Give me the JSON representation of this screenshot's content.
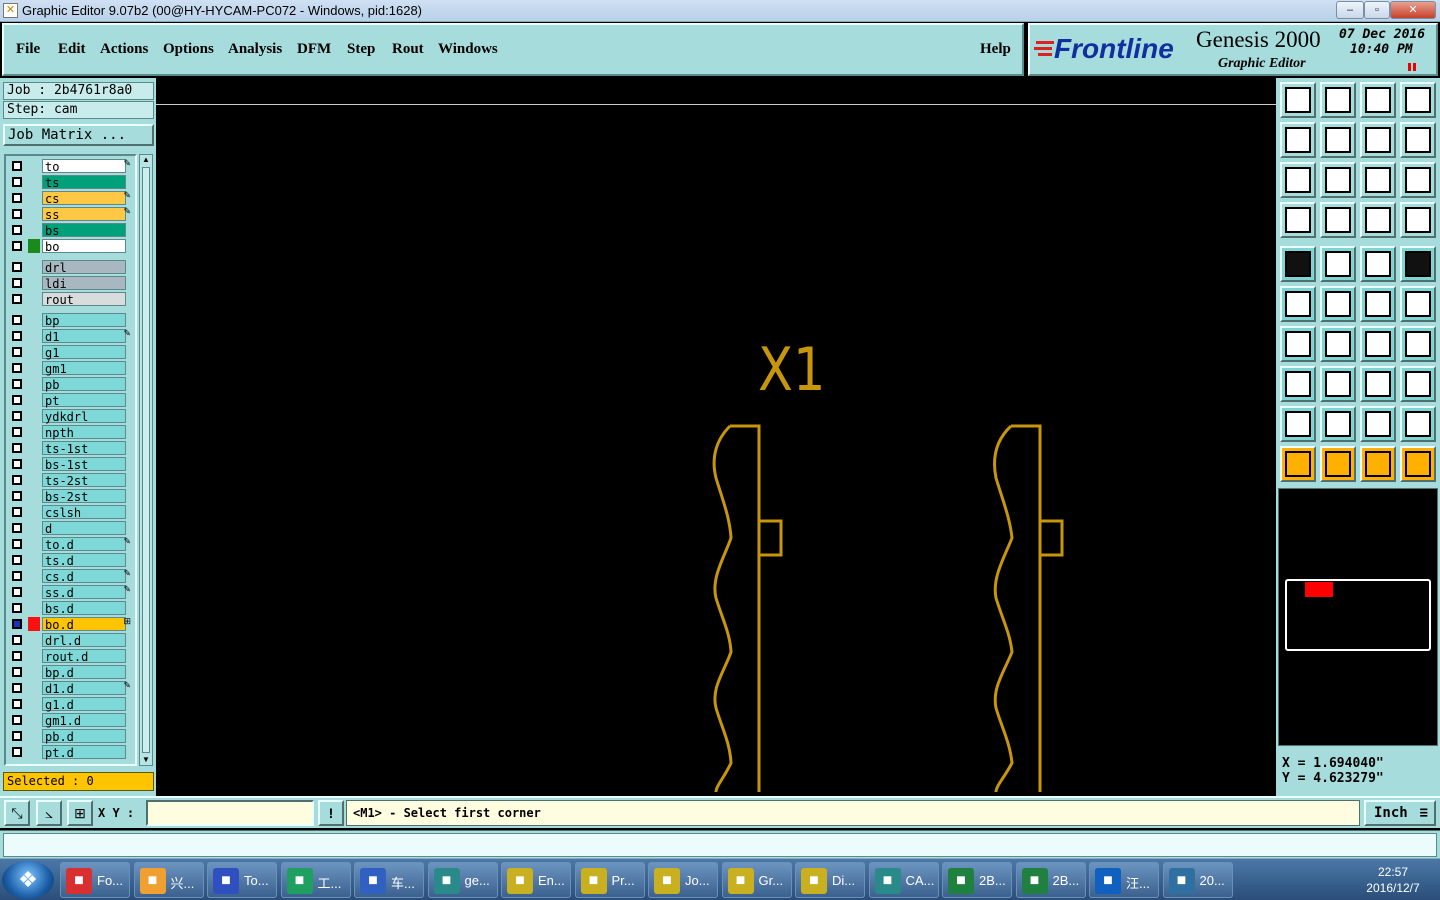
{
  "window": {
    "title": "Graphic Editor 9.07b2 (00@HY-HYCAM-PC072 - Windows, pid:1628)",
    "controls": [
      "–",
      "▫",
      "✕"
    ]
  },
  "menu": {
    "items": [
      "File",
      "Edit",
      "Actions",
      "Options",
      "Analysis",
      "DFM",
      "Step",
      "Rout",
      "Windows"
    ],
    "help": "Help"
  },
  "brand": {
    "logo": "Frontline",
    "product": "Genesis 2000",
    "subtitle": "Graphic Editor",
    "date": "07 Dec 2016",
    "time": "10:40 PM"
  },
  "job": {
    "job_label": "Job : 2b4761r8a0",
    "step_label": "Step: cam",
    "matrix_button": "Job Matrix ..."
  },
  "layers": [
    {
      "name": "to",
      "color": "#ffffff",
      "mark": "✎"
    },
    {
      "name": "ts",
      "color": "#00a07a",
      "mark": ""
    },
    {
      "name": "cs",
      "color": "#ffc844",
      "mark": "✎"
    },
    {
      "name": "ss",
      "color": "#ffc844",
      "mark": "✎"
    },
    {
      "name": "bs",
      "color": "#00a07a",
      "mark": ""
    },
    {
      "name": "bo",
      "color": "#ffffff",
      "mark": ""
    },
    {
      "name": "drl",
      "color": "#a9b8c0",
      "mark": ""
    },
    {
      "name": "ldi",
      "color": "#a9b8c0",
      "mark": ""
    },
    {
      "name": "rout",
      "color": "#d8dcdc",
      "mark": ""
    },
    {
      "name": "bp",
      "color": "#7fd8d8",
      "mark": ""
    },
    {
      "name": "d1",
      "color": "#7fd8d8",
      "mark": "✎"
    },
    {
      "name": "g1",
      "color": "#7fd8d8",
      "mark": ""
    },
    {
      "name": "gm1",
      "color": "#7fd8d8",
      "mark": ""
    },
    {
      "name": "pb",
      "color": "#7fd8d8",
      "mark": ""
    },
    {
      "name": "pt",
      "color": "#7fd8d8",
      "mark": ""
    },
    {
      "name": "ydkdrl",
      "color": "#7fd8d8",
      "mark": ""
    },
    {
      "name": "npth",
      "color": "#7fd8d8",
      "mark": ""
    },
    {
      "name": "ts-1st",
      "color": "#7fd8d8",
      "mark": ""
    },
    {
      "name": "bs-1st",
      "color": "#7fd8d8",
      "mark": ""
    },
    {
      "name": "ts-2st",
      "color": "#7fd8d8",
      "mark": ""
    },
    {
      "name": "bs-2st",
      "color": "#7fd8d8",
      "mark": ""
    },
    {
      "name": "cslsh",
      "color": "#7fd8d8",
      "mark": ""
    },
    {
      "name": "d",
      "color": "#7fd8d8",
      "mark": ""
    },
    {
      "name": "to.d",
      "color": "#7fd8d8",
      "mark": "✎"
    },
    {
      "name": "ts.d",
      "color": "#7fd8d8",
      "mark": ""
    },
    {
      "name": "cs.d",
      "color": "#7fd8d8",
      "mark": "✎"
    },
    {
      "name": "ss.d",
      "color": "#7fd8d8",
      "mark": "✎"
    },
    {
      "name": "bs.d",
      "color": "#7fd8d8",
      "mark": ""
    },
    {
      "name": "bo.d",
      "color": "#ffc400",
      "mark": "⊞"
    },
    {
      "name": "drl.d",
      "color": "#7fd8d8",
      "mark": ""
    },
    {
      "name": "rout.d",
      "color": "#7fd8d8",
      "mark": ""
    },
    {
      "name": "bp.d",
      "color": "#7fd8d8",
      "mark": ""
    },
    {
      "name": "d1.d",
      "color": "#7fd8d8",
      "mark": "✎"
    },
    {
      "name": "g1.d",
      "color": "#7fd8d8",
      "mark": ""
    },
    {
      "name": "gm1.d",
      "color": "#7fd8d8",
      "mark": ""
    },
    {
      "name": "pb.d",
      "color": "#7fd8d8",
      "mark": ""
    },
    {
      "name": "pt.d",
      "color": "#7fd8d8",
      "mark": ""
    }
  ],
  "selected": "Selected : 0",
  "canvas": {
    "label": "X1",
    "stroke_color": "#c8960a"
  },
  "coords": {
    "x": "X = 1.694040\"",
    "y": "Y = 4.623279\""
  },
  "command": {
    "xy_label": "X Y :",
    "xy_value": "",
    "prompt": "<M1> - Select first corner",
    "unit": "Inch"
  },
  "taskbar": {
    "items": [
      "Fo...",
      "兴...",
      "To...",
      "工...",
      "车...",
      "ge...",
      "En...",
      "Pr...",
      "Jo...",
      "Gr...",
      "Di...",
      "CA...",
      "2B...",
      "2B...",
      "汪...",
      "20..."
    ],
    "time": "22:57",
    "date": "2016/12/7"
  }
}
